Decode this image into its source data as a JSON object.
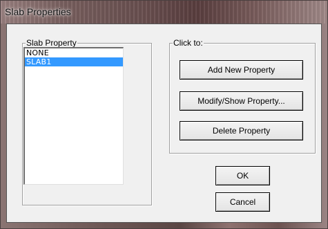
{
  "window": {
    "title": "Slab Properties"
  },
  "slab_property": {
    "label": "Slab Property",
    "items": [
      {
        "label": "NONE",
        "selected": false
      },
      {
        "label": "SLAB1",
        "selected": true
      }
    ]
  },
  "click_to": {
    "label": "Click to:",
    "add_label": "Add New Property",
    "modify_label": "Modify/Show Property...",
    "delete_label": "Delete Property"
  },
  "footer": {
    "ok_label": "OK",
    "cancel_label": "Cancel"
  },
  "colors": {
    "selection": "#3399ff",
    "dialog_face": "#f0f0f0"
  }
}
